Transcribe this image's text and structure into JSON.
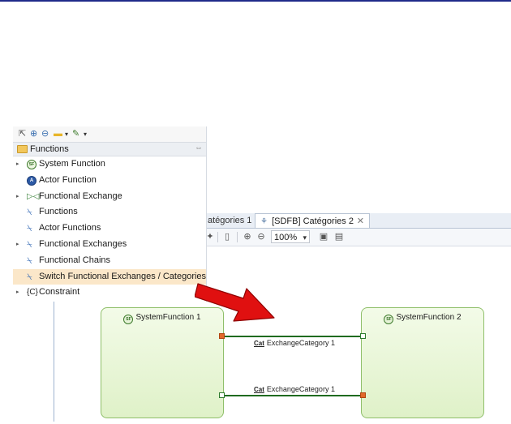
{
  "palette": {
    "header": "Functions",
    "tools": [
      "select-icon",
      "zoom-in-icon",
      "zoom-out-icon",
      "note-icon",
      "dropdown-icon",
      "pin-icon",
      "dropdown-icon"
    ],
    "items": [
      {
        "label": "System Function",
        "icon": "system-function-icon",
        "expandable": true
      },
      {
        "label": "Actor Function",
        "icon": "actor-function-icon",
        "expandable": false
      },
      {
        "label": "Functional Exchange",
        "icon": "functional-exchange-icon",
        "expandable": true
      },
      {
        "label": "Functions",
        "icon": "filter-icon",
        "expandable": false
      },
      {
        "label": "Actor Functions",
        "icon": "filter-icon",
        "expandable": false
      },
      {
        "label": "Functional Exchanges",
        "icon": "filter-icon",
        "expandable": true
      },
      {
        "label": "Functional Chains",
        "icon": "filter-icon",
        "expandable": false
      },
      {
        "label": "Switch Functional Exchanges / Categories",
        "icon": "filter-icon",
        "expandable": false,
        "selected": true
      },
      {
        "label": "Constraint",
        "icon": "constraint-icon",
        "expandable": true
      }
    ]
  },
  "editor": {
    "tabs": [
      {
        "label": "atégories 1",
        "active": false
      },
      {
        "label": "[SDFB] Catégories 2",
        "active": true
      }
    ],
    "zoom": "100%"
  },
  "diagram": {
    "functions": [
      {
        "name": "SystemFunction 1",
        "badge": "SF"
      },
      {
        "name": "SystemFunction 2",
        "badge": "SF"
      }
    ],
    "exchanges": [
      {
        "cat": "Cat",
        "label": "ExchangeCategory 1"
      },
      {
        "cat": "Cat",
        "label": "ExchangeCategory 1"
      }
    ]
  },
  "colors": {
    "selection": "#fbe7c9",
    "function_fill": "#dff1c8",
    "exchange_line": "#1f6b1f",
    "arrow": "#e01010"
  }
}
